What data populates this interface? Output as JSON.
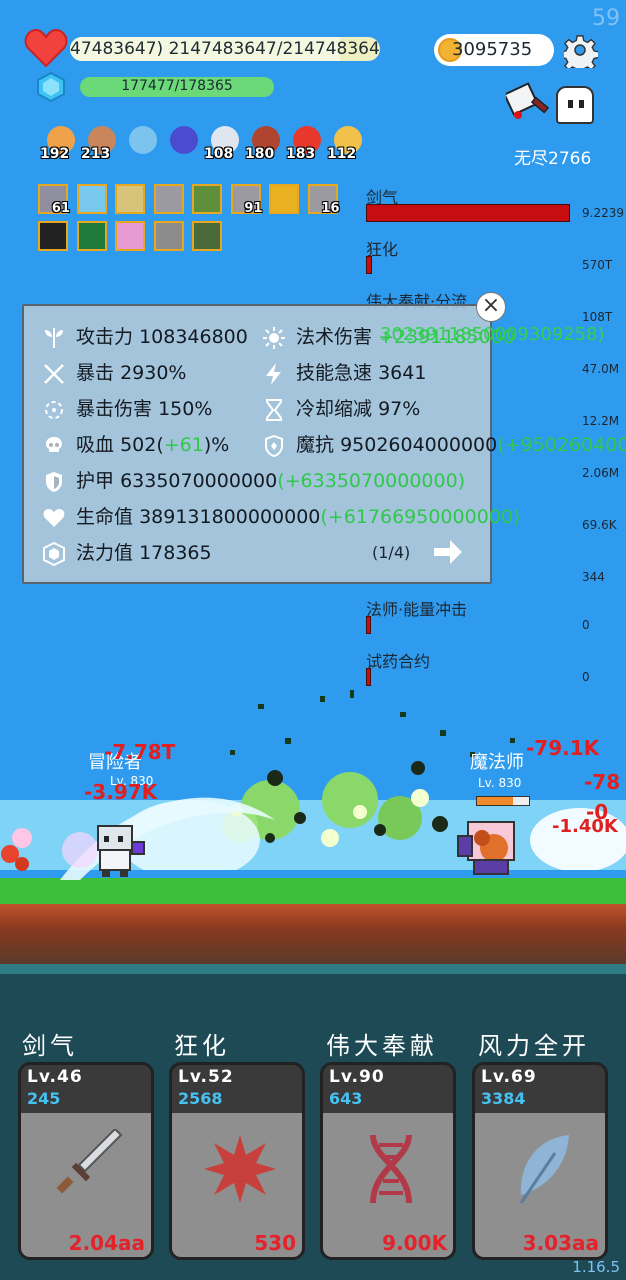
{
  "fps": "59",
  "version": "1.16.5",
  "player": {
    "hp_text": "47483647) 2147483647/2147483647",
    "mp_text": "177477/178365",
    "gold": "3095735",
    "endless_label": "无尽2766"
  },
  "inventory": [
    {
      "icon": "egg-icon",
      "count": "192",
      "color": "#f0a24a"
    },
    {
      "icon": "shield-icon",
      "count": "213",
      "color": "#c8865a"
    },
    {
      "icon": "orbs-icon",
      "count": "",
      "color": "#7cc3f0"
    },
    {
      "icon": "wizard-hat-icon",
      "count": "",
      "color": "#4b4bd0"
    },
    {
      "icon": "horn-icon",
      "count": "108",
      "color": "#dfe6ee"
    },
    {
      "icon": "jar-icon",
      "count": "180",
      "color": "#b0452f"
    },
    {
      "icon": "boot-icon",
      "count": "183",
      "color": "#e8382b"
    },
    {
      "icon": "crown-icon",
      "count": "112",
      "color": "#f2c14a"
    }
  ],
  "skill_icons_row1": [
    "61",
    "",
    "",
    "",
    "",
    "91",
    "",
    "16"
  ],
  "skill_icons_row2": [
    "",
    "",
    "",
    "",
    ""
  ],
  "dps_list": [
    {
      "name": "剑气",
      "value": "9.2239"
    },
    {
      "name": "狂化",
      "value": "570T"
    },
    {
      "name": "伟大奉献·分流",
      "value": "108T"
    },
    {
      "name": "",
      "value": "47.0M"
    },
    {
      "name": "",
      "value": "12.2M"
    },
    {
      "name": "",
      "value": "2.06M"
    },
    {
      "name": "",
      "value": "69.6K"
    },
    {
      "name": "",
      "value": "344"
    },
    {
      "name": "法师·能量冲击",
      "value": "0"
    },
    {
      "name": "试药合约",
      "value": "0"
    }
  ],
  "stats": {
    "attack_label": "攻击力",
    "attack_value": "108346800",
    "magic_dmg_label": "法术伤害",
    "magic_dmg_extra": "+2391185000",
    "overflow_green": "3023911850009309258)",
    "crit_label": "暴击",
    "crit_value": "2930%",
    "haste_label": "技能急速",
    "haste_value": "3641",
    "critdmg_label": "暴击伤害",
    "critdmg_value": "150%",
    "cdr_label": "冷却缩减",
    "cdr_value": "97%",
    "lifesteal_label": "吸血",
    "lifesteal_value": "502",
    "lifesteal_bonus": "+61",
    "lifesteal_unit": "%",
    "mres_label": "魔抗",
    "mres_value": "9502604000000",
    "mres_bonus": "(+950260400",
    "armor_label": "护甲",
    "armor_value": "6335070000000",
    "armor_bonus": "(+6335070000000)",
    "hp_label": "生命值",
    "hp_value": "389131800000000",
    "hp_bonus": "(+61766950000000)",
    "mp_label": "法力值",
    "mp_value": "178365",
    "page": "(1/4)"
  },
  "battle": {
    "hero_name": "冒险者",
    "hero_level": "Lv. 830",
    "hero_dmg1": "-7.78T",
    "hero_dmg2": "-3.97K",
    "enemy_name": "魔法师",
    "enemy_level": "Lv. 830",
    "enemy_dmg1": "-79.1K",
    "enemy_dmg2": "-78",
    "enemy_dmg3": "-0",
    "enemy_dmg4": "-1.40K"
  },
  "skills": [
    {
      "name": "剑气",
      "level": "Lv.46",
      "points": "245",
      "cost": "2.04aa",
      "icon": "sword-icon"
    },
    {
      "name": "狂化",
      "level": "Lv.52",
      "points": "2568",
      "cost": "530",
      "icon": "rage-splat-icon"
    },
    {
      "name": "伟大奉献",
      "level": "Lv.90",
      "points": "643",
      "cost": "9.00K",
      "icon": "dna-icon"
    },
    {
      "name": "风力全开",
      "level": "Lv.69",
      "points": "3384",
      "cost": "3.03aa",
      "icon": "feather-icon"
    }
  ],
  "colors": {
    "sky": "#2f9bef",
    "bar_red": "#c60d10",
    "green_text": "#2fc84a",
    "damage_red": "#e02020"
  }
}
